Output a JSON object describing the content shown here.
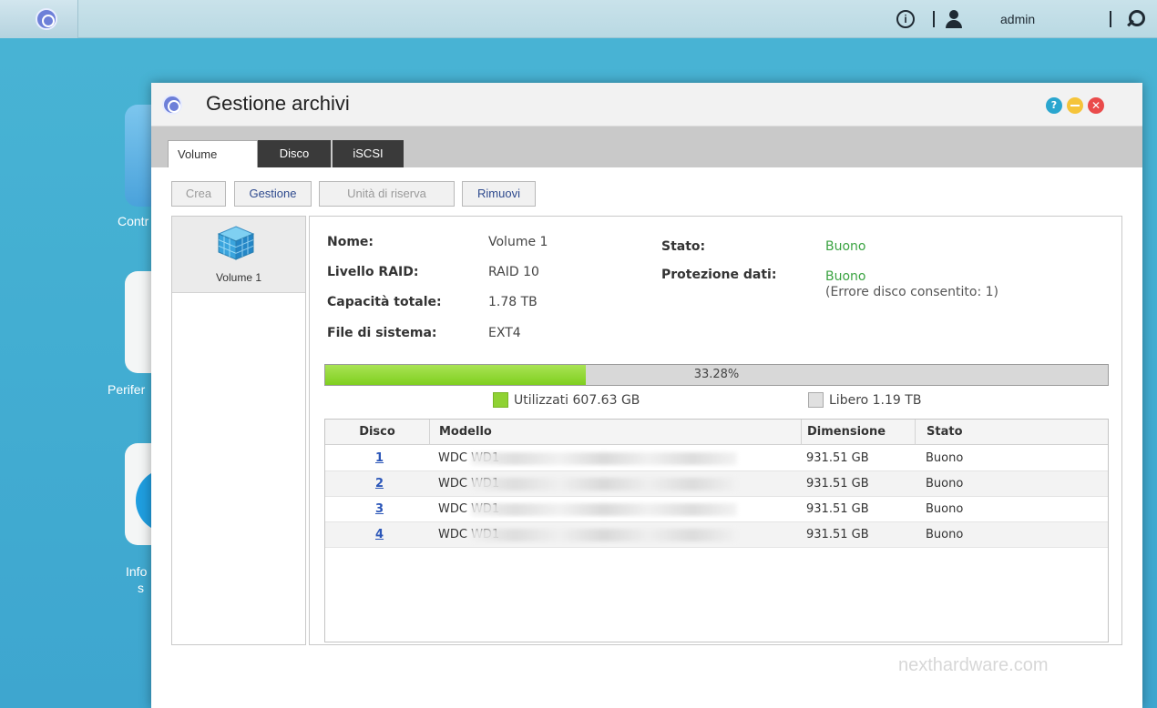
{
  "topbar": {
    "user": "admin",
    "info_glyph": "i"
  },
  "desktop": {
    "labels": [
      "Contr",
      "Perifer",
      "Info",
      "s"
    ]
  },
  "window": {
    "title": "Gestione archivi",
    "help_glyph": "?",
    "close_glyph": "✕",
    "tabs": [
      {
        "label": "Volume",
        "active": true
      },
      {
        "label": "Disco",
        "active": false
      },
      {
        "label": "iSCSI",
        "active": false
      }
    ],
    "toolbar": [
      {
        "label": "Crea",
        "enabled": false
      },
      {
        "label": "Gestione",
        "enabled": true
      },
      {
        "label": "Unità di riserva",
        "enabled": false
      },
      {
        "label": "Rimuovi",
        "enabled": true
      }
    ]
  },
  "sidebar": {
    "items": [
      {
        "label": "Volume 1",
        "icon": "cube-icon"
      }
    ]
  },
  "details": {
    "nome_label": "Nome:",
    "nome_value": "Volume 1",
    "raid_label": "Livello RAID:",
    "raid_value": "RAID 10",
    "capacita_label": "Capacità totale:",
    "capacita_value": "1.78 TB",
    "fs_label": "File di sistema:",
    "fs_value": "EXT4",
    "stato_label": "Stato:",
    "stato_value": "Buono",
    "protezione_label": "Protezione dati:",
    "protezione_value": "Buono",
    "protezione_note": "(Errore disco consentito: 1)"
  },
  "usage": {
    "percent_label": "33.28%",
    "fraction": 0.3328,
    "used_label": "Utilizzati 607.63 GB",
    "free_label": "Libero 1.19 TB",
    "used_color": "#8fd233",
    "free_color": "#e0e0e0"
  },
  "disk_table": {
    "columns": [
      "Disco",
      "Modello",
      "Dimensione",
      "Stato"
    ],
    "rows": [
      {
        "disco": "1",
        "modello": "WDC WD1",
        "dimensione": "931.51 GB",
        "stato": "Buono"
      },
      {
        "disco": "2",
        "modello": "WDC WD1",
        "dimensione": "931.51 GB",
        "stato": "Buono"
      },
      {
        "disco": "3",
        "modello": "WDC WD1",
        "dimensione": "931.51 GB",
        "stato": "Buono"
      },
      {
        "disco": "4",
        "modello": "WDC WD1",
        "dimensione": "931.51 GB",
        "stato": "Buono"
      }
    ]
  },
  "watermark": "nexthardware.com"
}
